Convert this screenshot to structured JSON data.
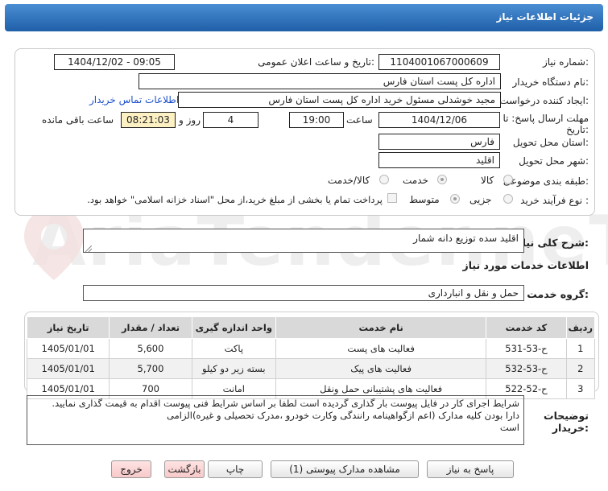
{
  "header": {
    "title": "جزئیات اطلاعات نیاز"
  },
  "info": {
    "need_number_label": "شماره نیاز:",
    "need_number": "1104001067000609",
    "announce_label": "تاریخ و ساعت اعلان عمومی:",
    "announce_value": "1404/12/02 - 09:05",
    "buyer_org_label": "نام دستگاه خریدار:",
    "buyer_org": "اداره کل پست استان فارس",
    "requester_label": "ایجاد کننده درخواست:",
    "requester": "مجید خوشدلی مسئول خرید اداره کل پست استان فارس",
    "contact_link": "اطلاعات تماس خریدار",
    "deadline_label_1": "مهلت ارسال پاسخ: تا",
    "deadline_label_2": "تاریخ:",
    "deadline_date": "1404/12/06",
    "time_label": "ساعت",
    "deadline_time": "19:00",
    "days_value": "4",
    "days_label": "روز و",
    "remaining_value": "08:21:03",
    "remaining_label": "ساعت باقی مانده",
    "province_label": "استان محل تحویل:",
    "province": "فارس",
    "city_label": "شهر محل تحویل:",
    "city": "اقلید",
    "category_label": "طبقه بندی موضوعی:",
    "category_options": [
      "کالا",
      "خدمت",
      "کالا/خدمت"
    ],
    "category_selected": "خدمت",
    "process_label": "نوع فرآیند خرید :",
    "process_options": [
      "جزیی",
      "متوسط"
    ],
    "process_selected": "متوسط",
    "payment_note": "پرداخت تمام یا بخشی از مبلغ خرید،از محل \"اسناد خزانه اسلامی\" خواهد بود."
  },
  "description": {
    "label": "شرح کلی نیاز:",
    "value": "اقلید سده توزیع دانه شمار"
  },
  "services": {
    "section_title": "اطلاعات خدمات مورد نیاز",
    "group_label": "گروه خدمت:",
    "group_value": "حمل و نقل و انبارداری",
    "columns": [
      "ردیف",
      "کد خدمت",
      "نام خدمت",
      "واحد اندازه گیری",
      "تعداد / مقدار",
      "تاریخ نیاز"
    ],
    "rows": [
      {
        "row": "1",
        "code": "ح-53-531",
        "name": "فعالیت های پست",
        "unit": "پاکت",
        "qty": "5,600",
        "date": "1405/01/01"
      },
      {
        "row": "2",
        "code": "ح-53-532",
        "name": "فعالیت های پیک",
        "unit": "بسته زیر دو کیلو",
        "qty": "5,700",
        "date": "1405/01/01"
      },
      {
        "row": "3",
        "code": "ح-52-522",
        "name": "فعالیت های پشتیبانی حمل ونقل",
        "unit": "امانت",
        "qty": "700",
        "date": "1405/01/01"
      }
    ]
  },
  "buyer_notes": {
    "label_1": "توضیحات",
    "label_2": "خریدار:",
    "line_1": "شرایط اجرای کار در فایل پیوست بار گذاری گردیده است لطفا بر اساس شرایط فنی پیوست اقدام به قیمت گذاری نمایید.",
    "line_2": "دارا بودن کلیه مدارک (اعم ازگواهینامه رانندگی وکارت خودرو ،مدرک تحصیلی و غیره)الزامی",
    "line_3": "است"
  },
  "buttons": {
    "reply": "پاسخ به نیاز",
    "attachments": "مشاهده مدارک پیوستی (1)",
    "print": "چاپ",
    "back": "بازگشت",
    "exit": "خروج"
  },
  "watermark": {
    "text": "AriaTender.neT"
  },
  "colors": {
    "header": "#2f74c0",
    "remaining_bg": "#fdf1c4",
    "link": "#1a4fcc"
  }
}
